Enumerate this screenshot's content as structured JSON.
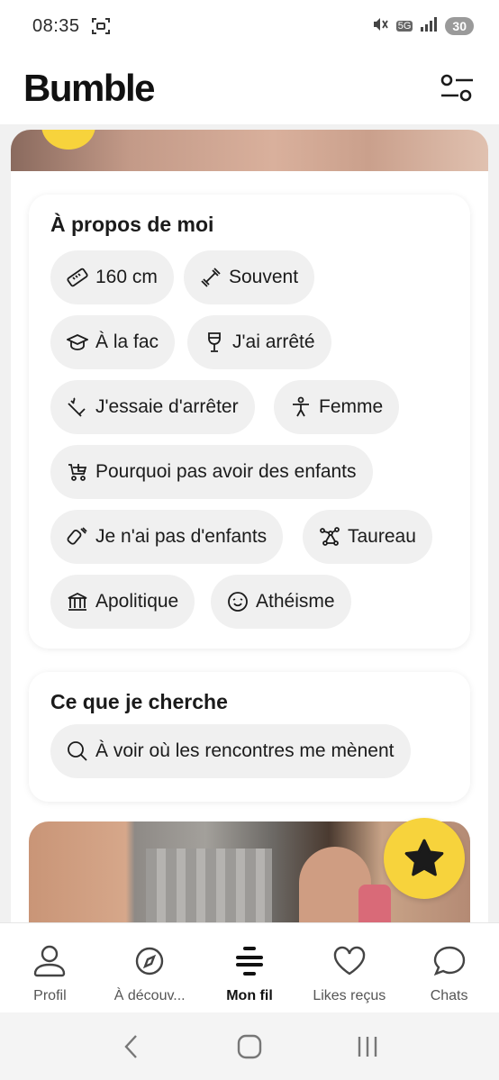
{
  "status_bar": {
    "time": "08:35",
    "battery": "30",
    "network": "5G"
  },
  "header": {
    "logo": "Bumble"
  },
  "about": {
    "title": "À propos de moi",
    "chips": [
      {
        "label": "160 cm",
        "icon": "ruler-icon"
      },
      {
        "label": "Souvent",
        "icon": "dumbbell-icon"
      },
      {
        "label": "À la fac",
        "icon": "graduation-cap-icon"
      },
      {
        "label": "J'ai arrêté",
        "icon": "wine-glass-icon"
      },
      {
        "label": "J'essaie d'arrêter",
        "icon": "cigarette-icon"
      },
      {
        "label": "Femme",
        "icon": "person-icon"
      },
      {
        "label": "Pourquoi pas avoir des enfants",
        "icon": "stroller-icon"
      },
      {
        "label": "Je n'ai pas d'enfants",
        "icon": "baby-bottle-icon"
      },
      {
        "label": "Taureau",
        "icon": "constellation-icon"
      },
      {
        "label": "Apolitique",
        "icon": "government-building-icon"
      },
      {
        "label": "Athéisme",
        "icon": "smiley-icon"
      }
    ]
  },
  "seeking": {
    "title": "Ce que je cherche",
    "chip": {
      "label": "À voir où les rencontres me mènent",
      "icon": "search-icon"
    }
  },
  "nav": {
    "items": [
      {
        "label": "Profil",
        "icon": "profile-icon"
      },
      {
        "label": "À découv...",
        "icon": "compass-icon"
      },
      {
        "label": "Mon fil",
        "icon": "feed-icon"
      },
      {
        "label": "Likes reçus",
        "icon": "heart-icon"
      },
      {
        "label": "Chats",
        "icon": "chat-bubble-icon"
      }
    ],
    "active": "Mon fil"
  },
  "colors": {
    "brand_yellow": "#f7d33c",
    "chip_bg": "#f0f0f0",
    "feed_bg": "#f1f1f1"
  }
}
